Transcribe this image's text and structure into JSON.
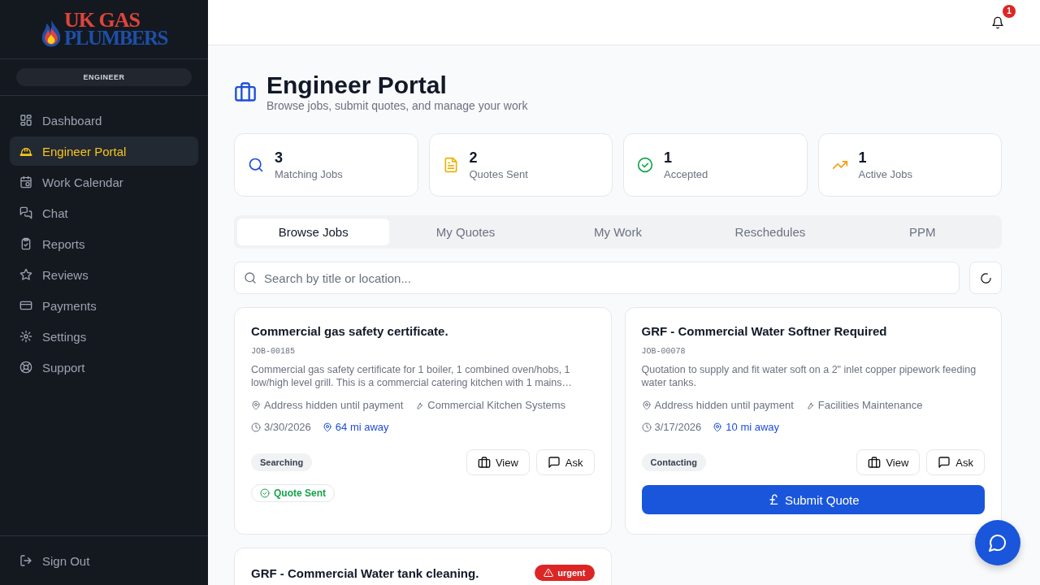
{
  "sidebar": {
    "logo": {
      "line1": "UK GAS",
      "line2": "PLUMBERS"
    },
    "role": "ENGINEER",
    "items": [
      {
        "label": "Dashboard",
        "selected": false
      },
      {
        "label": "Engineer Portal",
        "selected": true
      },
      {
        "label": "Work Calendar",
        "selected": false
      },
      {
        "label": "Chat",
        "selected": false
      },
      {
        "label": "Reports",
        "selected": false
      },
      {
        "label": "Reviews",
        "selected": false
      },
      {
        "label": "Payments",
        "selected": false
      },
      {
        "label": "Settings",
        "selected": false
      },
      {
        "label": "Support",
        "selected": false
      }
    ],
    "sign_out": "Sign Out"
  },
  "topbar": {
    "notifications": "1"
  },
  "header": {
    "title": "Engineer Portal",
    "subtitle": "Browse jobs, submit quotes, and manage your work"
  },
  "stats": [
    {
      "kind": "search",
      "value": "3",
      "label": "Matching Jobs",
      "color": "#1d4ed8"
    },
    {
      "kind": "document",
      "value": "2",
      "label": "Quotes Sent",
      "color": "#eab308"
    },
    {
      "kind": "check",
      "value": "1",
      "label": "Accepted",
      "color": "#16a34a"
    },
    {
      "kind": "trend",
      "value": "1",
      "label": "Active Jobs",
      "color": "#f59e0b"
    }
  ],
  "tabs": [
    {
      "label": "Browse Jobs",
      "selected": true
    },
    {
      "label": "My Quotes",
      "selected": false
    },
    {
      "label": "My Work",
      "selected": false
    },
    {
      "label": "Reschedules",
      "selected": false
    },
    {
      "label": "PPM",
      "selected": false
    }
  ],
  "search": {
    "placeholder": "Search by title or location..."
  },
  "jobs": [
    {
      "title": "Commercial gas safety certificate.",
      "code": "JOB-00185",
      "description": "Commercial gas safety certificate for 1 boiler, 1 combined oven/hobs, 1 low/high level grill. This is a commercial catering kitchen with 1 mains…",
      "address": "Address hidden until payment",
      "category": "Commercial Kitchen Systems",
      "date": "3/30/2026",
      "distance": "64 mi away",
      "status": "Searching",
      "view": "View",
      "ask": "Ask",
      "quote_sent": "Quote Sent"
    },
    {
      "title": "GRF - Commercial Water Softner Required",
      "code": "JOB-00078",
      "description": "Quotation to supply and fit water soft on a 2\" inlet copper pipework feeding water tanks.",
      "address": "Address hidden until payment",
      "category": "Facilities Maintenance",
      "date": "3/17/2026",
      "distance": "10 mi away",
      "status": "Contacting",
      "view": "View",
      "ask": "Ask",
      "submit": "Submit Quote"
    },
    {
      "title": "GRF - Commercial Water tank cleaning.",
      "urgent": "urgent"
    }
  ]
}
